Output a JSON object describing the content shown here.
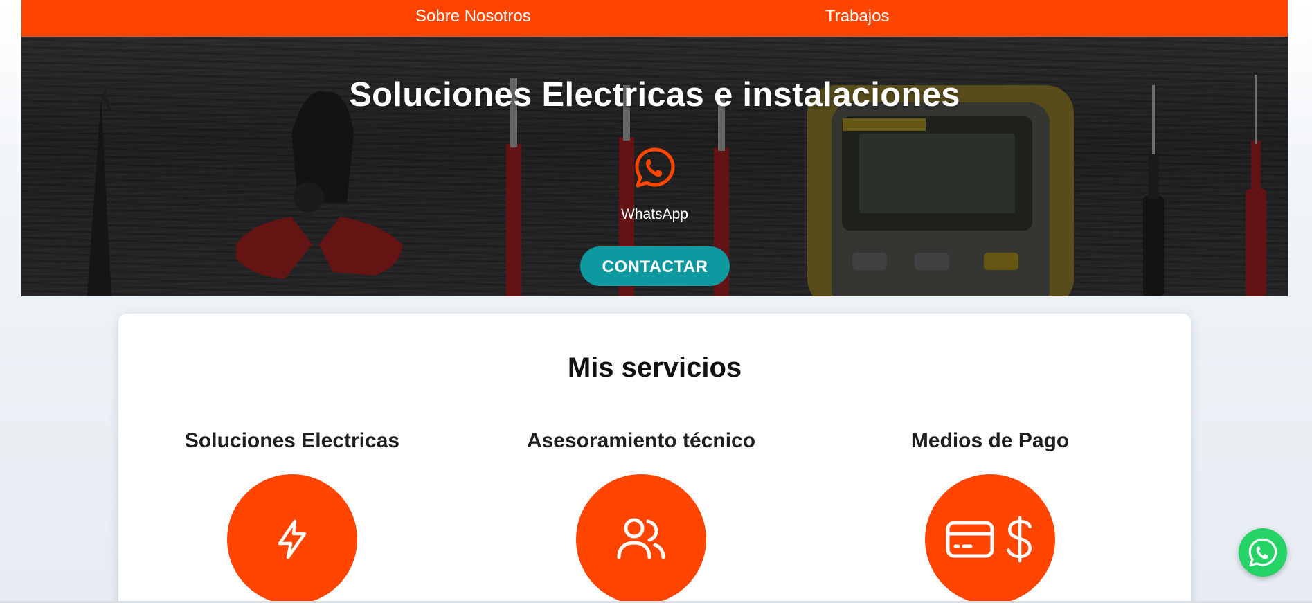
{
  "nav": {
    "about_label": "Sobre Nosotros",
    "jobs_label": "Trabajos"
  },
  "hero": {
    "title": "Soluciones Electricas e instalaciones",
    "whatsapp_label": "WhatsApp",
    "contact_label": "CONTACTAR",
    "icon": "whatsapp-icon"
  },
  "services": {
    "title": "Mis servicios",
    "items": [
      {
        "title": "Soluciones Electricas",
        "icon": "lightning-icon"
      },
      {
        "title": "Asesoramiento técnico",
        "icon": "users-icon"
      },
      {
        "title": "Medios de Pago",
        "icon": "credit-card-icon, dollar-icon"
      }
    ]
  },
  "floating": {
    "icon": "whatsapp-icon"
  },
  "colors": {
    "brand_orange": "#ff4500",
    "contact_teal": "#0e98a0",
    "whatsapp_green": "#25d366"
  }
}
